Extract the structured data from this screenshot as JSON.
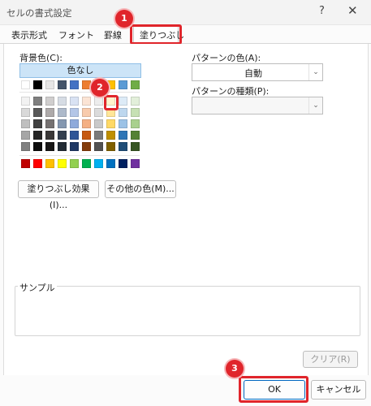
{
  "window": {
    "title": "セルの書式設定",
    "help": "?",
    "close": "✕"
  },
  "tabs": [
    "表示形式",
    "フォント",
    "罫線",
    "塗りつぶし"
  ],
  "fill": {
    "background_label": "背景色(C):",
    "no_color": "色なし",
    "effects_button": "塗りつぶし効果(I)...",
    "more_colors_button": "その他の色(M)..."
  },
  "pattern": {
    "color_label": "パターンの色(A):",
    "color_value": "自動",
    "style_label": "パターンの種類(P):",
    "style_value": ""
  },
  "sample": {
    "label": "サンプル"
  },
  "buttons": {
    "clear": "クリア(R)",
    "ok": "OK",
    "cancel": "キャンセル"
  },
  "annotations": [
    "1",
    "2",
    "3"
  ],
  "palette": {
    "theme_top": [
      "#ffffff",
      "#000000",
      "#e7e6e6",
      "#44546a",
      "#4472c4",
      "#ed7d31",
      "#a5a5a5",
      "#ffc000",
      "#5b9bd5",
      "#70ad47"
    ],
    "theme_shades": [
      [
        "#f2f2f2",
        "#7f7f7f",
        "#d0cece",
        "#d6dce4",
        "#d9e2f3",
        "#fbe4d5",
        "#ededed",
        "#fff2cc",
        "#ddebf7",
        "#e2efda"
      ],
      [
        "#d9d9d9",
        "#595959",
        "#aeaaaa",
        "#adb9ca",
        "#b4c6e7",
        "#f8cbad",
        "#dbdbdb",
        "#ffe699",
        "#bdd7ee",
        "#c6e0b4"
      ],
      [
        "#bfbfbf",
        "#404040",
        "#757171",
        "#8497b0",
        "#8eaadb",
        "#f4b084",
        "#c9c9c9",
        "#ffd966",
        "#9bc2e6",
        "#a9d08e"
      ],
      [
        "#a6a6a6",
        "#262626",
        "#3a3838",
        "#333f4f",
        "#2f5597",
        "#c65911",
        "#7b7b7b",
        "#bf8f00",
        "#2e75b6",
        "#548235"
      ],
      [
        "#808080",
        "#0d0d0d",
        "#171616",
        "#222b35",
        "#1f3864",
        "#833c0b",
        "#525252",
        "#7f6000",
        "#1f4e78",
        "#375623"
      ]
    ],
    "standard": [
      "#c00000",
      "#ff0000",
      "#ffc000",
      "#ffff00",
      "#92d050",
      "#00b050",
      "#00b0f0",
      "#0070c0",
      "#002060",
      "#7030a0"
    ]
  }
}
